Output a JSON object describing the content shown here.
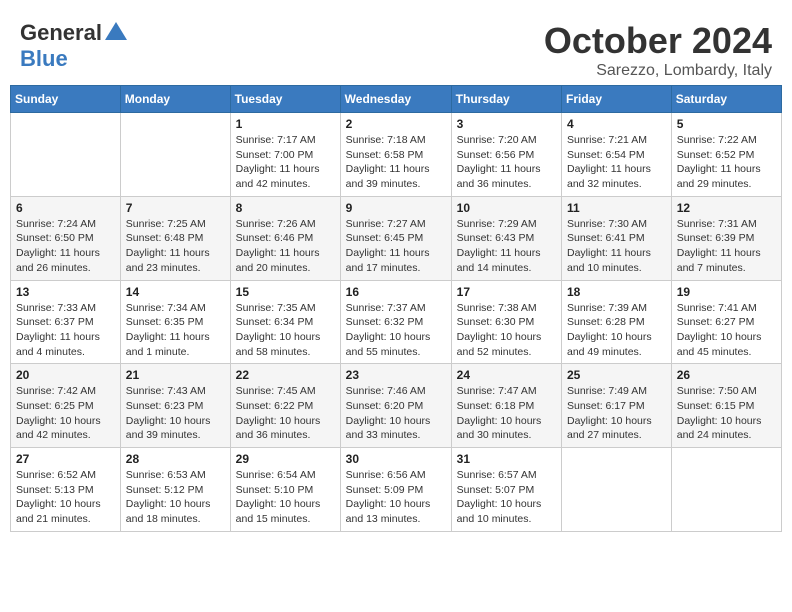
{
  "header": {
    "logo_general": "General",
    "logo_blue": "Blue",
    "month": "October 2024",
    "location": "Sarezzo, Lombardy, Italy"
  },
  "days_of_week": [
    "Sunday",
    "Monday",
    "Tuesday",
    "Wednesday",
    "Thursday",
    "Friday",
    "Saturday"
  ],
  "weeks": [
    [
      {
        "day": "",
        "sunrise": "",
        "sunset": "",
        "daylight": ""
      },
      {
        "day": "",
        "sunrise": "",
        "sunset": "",
        "daylight": ""
      },
      {
        "day": "1",
        "sunrise": "Sunrise: 7:17 AM",
        "sunset": "Sunset: 7:00 PM",
        "daylight": "Daylight: 11 hours and 42 minutes."
      },
      {
        "day": "2",
        "sunrise": "Sunrise: 7:18 AM",
        "sunset": "Sunset: 6:58 PM",
        "daylight": "Daylight: 11 hours and 39 minutes."
      },
      {
        "day": "3",
        "sunrise": "Sunrise: 7:20 AM",
        "sunset": "Sunset: 6:56 PM",
        "daylight": "Daylight: 11 hours and 36 minutes."
      },
      {
        "day": "4",
        "sunrise": "Sunrise: 7:21 AM",
        "sunset": "Sunset: 6:54 PM",
        "daylight": "Daylight: 11 hours and 32 minutes."
      },
      {
        "day": "5",
        "sunrise": "Sunrise: 7:22 AM",
        "sunset": "Sunset: 6:52 PM",
        "daylight": "Daylight: 11 hours and 29 minutes."
      }
    ],
    [
      {
        "day": "6",
        "sunrise": "Sunrise: 7:24 AM",
        "sunset": "Sunset: 6:50 PM",
        "daylight": "Daylight: 11 hours and 26 minutes."
      },
      {
        "day": "7",
        "sunrise": "Sunrise: 7:25 AM",
        "sunset": "Sunset: 6:48 PM",
        "daylight": "Daylight: 11 hours and 23 minutes."
      },
      {
        "day": "8",
        "sunrise": "Sunrise: 7:26 AM",
        "sunset": "Sunset: 6:46 PM",
        "daylight": "Daylight: 11 hours and 20 minutes."
      },
      {
        "day": "9",
        "sunrise": "Sunrise: 7:27 AM",
        "sunset": "Sunset: 6:45 PM",
        "daylight": "Daylight: 11 hours and 17 minutes."
      },
      {
        "day": "10",
        "sunrise": "Sunrise: 7:29 AM",
        "sunset": "Sunset: 6:43 PM",
        "daylight": "Daylight: 11 hours and 14 minutes."
      },
      {
        "day": "11",
        "sunrise": "Sunrise: 7:30 AM",
        "sunset": "Sunset: 6:41 PM",
        "daylight": "Daylight: 11 hours and 10 minutes."
      },
      {
        "day": "12",
        "sunrise": "Sunrise: 7:31 AM",
        "sunset": "Sunset: 6:39 PM",
        "daylight": "Daylight: 11 hours and 7 minutes."
      }
    ],
    [
      {
        "day": "13",
        "sunrise": "Sunrise: 7:33 AM",
        "sunset": "Sunset: 6:37 PM",
        "daylight": "Daylight: 11 hours and 4 minutes."
      },
      {
        "day": "14",
        "sunrise": "Sunrise: 7:34 AM",
        "sunset": "Sunset: 6:35 PM",
        "daylight": "Daylight: 11 hours and 1 minute."
      },
      {
        "day": "15",
        "sunrise": "Sunrise: 7:35 AM",
        "sunset": "Sunset: 6:34 PM",
        "daylight": "Daylight: 10 hours and 58 minutes."
      },
      {
        "day": "16",
        "sunrise": "Sunrise: 7:37 AM",
        "sunset": "Sunset: 6:32 PM",
        "daylight": "Daylight: 10 hours and 55 minutes."
      },
      {
        "day": "17",
        "sunrise": "Sunrise: 7:38 AM",
        "sunset": "Sunset: 6:30 PM",
        "daylight": "Daylight: 10 hours and 52 minutes."
      },
      {
        "day": "18",
        "sunrise": "Sunrise: 7:39 AM",
        "sunset": "Sunset: 6:28 PM",
        "daylight": "Daylight: 10 hours and 49 minutes."
      },
      {
        "day": "19",
        "sunrise": "Sunrise: 7:41 AM",
        "sunset": "Sunset: 6:27 PM",
        "daylight": "Daylight: 10 hours and 45 minutes."
      }
    ],
    [
      {
        "day": "20",
        "sunrise": "Sunrise: 7:42 AM",
        "sunset": "Sunset: 6:25 PM",
        "daylight": "Daylight: 10 hours and 42 minutes."
      },
      {
        "day": "21",
        "sunrise": "Sunrise: 7:43 AM",
        "sunset": "Sunset: 6:23 PM",
        "daylight": "Daylight: 10 hours and 39 minutes."
      },
      {
        "day": "22",
        "sunrise": "Sunrise: 7:45 AM",
        "sunset": "Sunset: 6:22 PM",
        "daylight": "Daylight: 10 hours and 36 minutes."
      },
      {
        "day": "23",
        "sunrise": "Sunrise: 7:46 AM",
        "sunset": "Sunset: 6:20 PM",
        "daylight": "Daylight: 10 hours and 33 minutes."
      },
      {
        "day": "24",
        "sunrise": "Sunrise: 7:47 AM",
        "sunset": "Sunset: 6:18 PM",
        "daylight": "Daylight: 10 hours and 30 minutes."
      },
      {
        "day": "25",
        "sunrise": "Sunrise: 7:49 AM",
        "sunset": "Sunset: 6:17 PM",
        "daylight": "Daylight: 10 hours and 27 minutes."
      },
      {
        "day": "26",
        "sunrise": "Sunrise: 7:50 AM",
        "sunset": "Sunset: 6:15 PM",
        "daylight": "Daylight: 10 hours and 24 minutes."
      }
    ],
    [
      {
        "day": "27",
        "sunrise": "Sunrise: 6:52 AM",
        "sunset": "Sunset: 5:13 PM",
        "daylight": "Daylight: 10 hours and 21 minutes."
      },
      {
        "day": "28",
        "sunrise": "Sunrise: 6:53 AM",
        "sunset": "Sunset: 5:12 PM",
        "daylight": "Daylight: 10 hours and 18 minutes."
      },
      {
        "day": "29",
        "sunrise": "Sunrise: 6:54 AM",
        "sunset": "Sunset: 5:10 PM",
        "daylight": "Daylight: 10 hours and 15 minutes."
      },
      {
        "day": "30",
        "sunrise": "Sunrise: 6:56 AM",
        "sunset": "Sunset: 5:09 PM",
        "daylight": "Daylight: 10 hours and 13 minutes."
      },
      {
        "day": "31",
        "sunrise": "Sunrise: 6:57 AM",
        "sunset": "Sunset: 5:07 PM",
        "daylight": "Daylight: 10 hours and 10 minutes."
      },
      {
        "day": "",
        "sunrise": "",
        "sunset": "",
        "daylight": ""
      },
      {
        "day": "",
        "sunrise": "",
        "sunset": "",
        "daylight": ""
      }
    ]
  ]
}
